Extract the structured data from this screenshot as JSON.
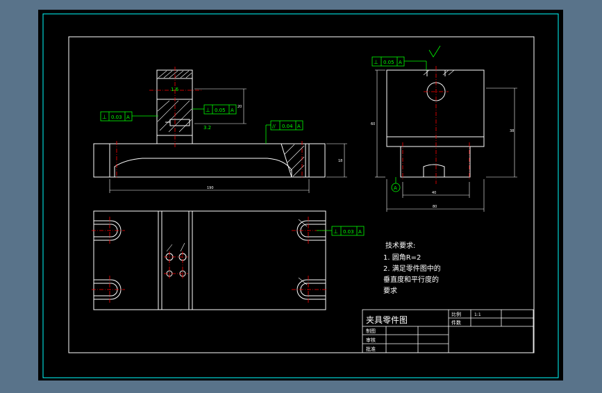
{
  "colors": {
    "desktop": "#59738a",
    "paper": "#000000",
    "frame": "#ffffff",
    "outer_frame": "#00ffff",
    "geometry": "#ffffff",
    "centerline": "#ff0000",
    "dimension": "#ffffff",
    "tolerance": "#00ff00",
    "hatch": "#ffffff",
    "text": "#ffffff"
  },
  "notes": {
    "heading": "技术要求:",
    "line1": "1. 圆角R=2",
    "line2": "2. 满足零件图中的",
    "line3": "垂直度和平行度的",
    "line4": "要求"
  },
  "title_block": {
    "title": "夹具零件图",
    "ratio_label": "比例",
    "ratio_value": "1:1",
    "count_label": "件数",
    "drawn_label": "制图",
    "checked_label": "审核",
    "approved_label": "批准"
  },
  "tolerances": {
    "front_left": {
      "symbol": "⊥",
      "value": "0.03",
      "datum": "A"
    },
    "front_mid": {
      "symbol": "⊥",
      "value": "0.05",
      "datum": "A"
    },
    "front_top": {
      "symbol": "//",
      "value": "0.04",
      "datum": "A"
    },
    "side_top": {
      "symbol": "⊥",
      "value": "0.05",
      "datum": "A"
    },
    "plan_right": {
      "symbol": "⊥",
      "value": "0.03",
      "datum": "A"
    }
  },
  "datum_label": "A",
  "dimensions": {
    "front_width": "190",
    "front_height": "18",
    "side_width": "80",
    "side_inner": "40",
    "side_height": "60",
    "side_height2": "38",
    "boss_height": "20",
    "roughness_1": "1.6",
    "roughness_2": "3.2"
  }
}
